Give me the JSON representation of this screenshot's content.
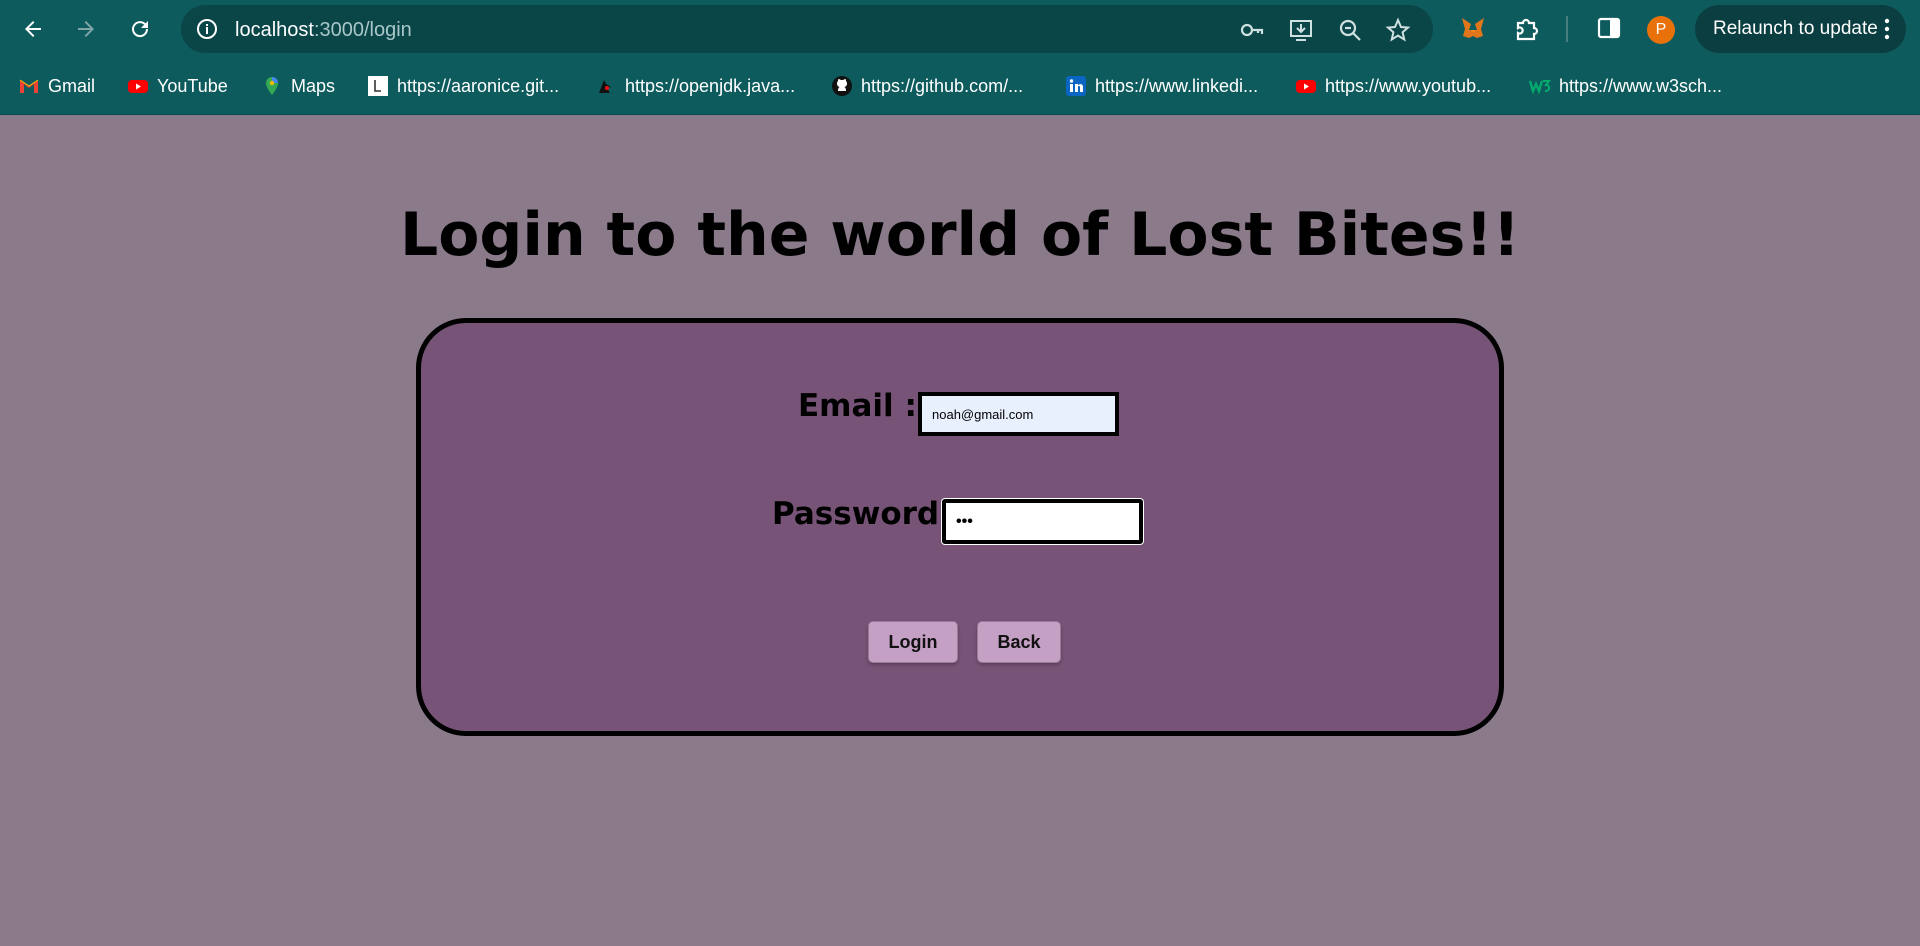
{
  "browser": {
    "url_host": "localhost",
    "url_path": ":3000/login",
    "profile_initial": "P",
    "relaunch_label": "Relaunch to update"
  },
  "bookmarks": [
    {
      "label": "Gmail",
      "icon": "gmail-icon"
    },
    {
      "label": "YouTube",
      "icon": "youtube-icon"
    },
    {
      "label": "Maps",
      "icon": "maps-icon"
    },
    {
      "label": "https://aaronice.git...",
      "icon": "page-l-icon"
    },
    {
      "label": "https://openjdk.java...",
      "icon": "duke-icon"
    },
    {
      "label": "https://github.com/...",
      "icon": "github-icon"
    },
    {
      "label": "https://www.linkedi...",
      "icon": "linkedin-icon"
    },
    {
      "label": "https://www.youtub...",
      "icon": "youtube-icon"
    },
    {
      "label": "https://www.w3sch...",
      "icon": "w3schools-icon"
    }
  ],
  "page": {
    "title": "Login to the world of Lost Bites!!",
    "email_label": "Email :",
    "email_value": "noah@gmail.com",
    "password_label": "Password :",
    "password_value": "•••",
    "login_label": "Login",
    "back_label": "Back"
  },
  "colors": {
    "chrome": "#0e5b5e",
    "page_bg": "#8a7a8a",
    "card_bg": "#775377",
    "button_bg": "#c4a0c4"
  }
}
